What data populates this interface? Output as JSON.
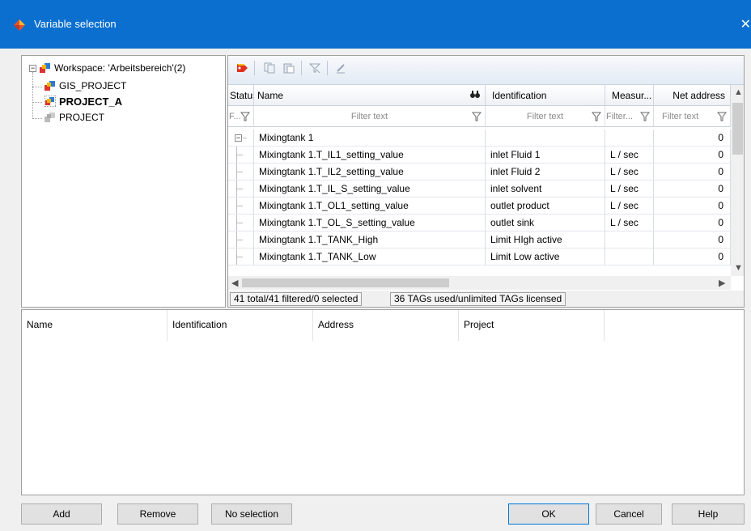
{
  "window": {
    "title": "Variable selection",
    "close_glyph": "✕"
  },
  "tree": {
    "root_label": "Workspace: 'Arbeitsbereich'(2)",
    "items": [
      {
        "label": "GIS_PROJECT",
        "bold": false
      },
      {
        "label": "PROJECT_A",
        "bold": true
      },
      {
        "label": "PROJECT",
        "bold": false
      }
    ]
  },
  "toolbar": {
    "icons": [
      "tag-icon",
      "copy-icon",
      "paste-icon",
      "filter-clear-icon",
      "edit-icon"
    ]
  },
  "grid": {
    "columns": [
      "Status",
      "Name",
      "Identification",
      "Measur...",
      "Net address"
    ],
    "filters": [
      "F...",
      "Filter text",
      "Filter text",
      "Filter...",
      "Filter text"
    ],
    "rows": [
      {
        "expander": "−",
        "name": "Mixingtank 1",
        "identification": "",
        "measure": "",
        "net": "0"
      },
      {
        "name": "Mixingtank 1.T_IL1_setting_value",
        "identification": "inlet Fluid 1",
        "measure": "L / sec",
        "net": "0"
      },
      {
        "name": "Mixingtank 1.T_IL2_setting_value",
        "identification": "inlet Fluid 2",
        "measure": "L / sec",
        "net": "0"
      },
      {
        "name": "Mixingtank 1.T_IL_S_setting_value",
        "identification": "inlet solvent",
        "measure": "L / sec",
        "net": "0"
      },
      {
        "name": "Mixingtank 1.T_OL1_setting_value",
        "identification": "outlet product",
        "measure": "L / sec",
        "net": "0"
      },
      {
        "name": "Mixingtank 1.T_OL_S_setting_value",
        "identification": "outlet sink",
        "measure": "L / sec",
        "net": "0"
      },
      {
        "name": "Mixingtank 1.T_TANK_High",
        "identification": "Limit HIgh active",
        "measure": "",
        "net": "0"
      },
      {
        "name": "Mixingtank 1.T_TANK_Low",
        "identification": "Limit Low active",
        "measure": "",
        "net": "0"
      }
    ]
  },
  "status": {
    "counts": "41 total/41 filtered/0 selected",
    "license": "36 TAGs used/unlimited TAGs licensed"
  },
  "selection": {
    "columns": [
      "Name",
      "Identification",
      "Address",
      "Project"
    ]
  },
  "buttons": {
    "add": "Add",
    "remove": "Remove",
    "no_selection": "No selection",
    "ok": "OK",
    "cancel": "Cancel",
    "help": "Help"
  }
}
